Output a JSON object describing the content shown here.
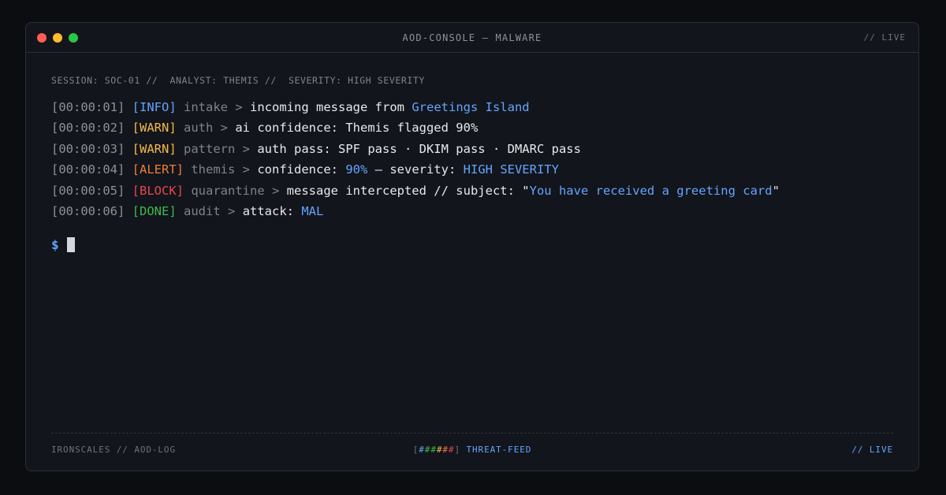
{
  "window": {
    "title": "AOD-CONSOLE — MALWARE",
    "live_label": "// LIVE",
    "dots": [
      {
        "name": "close",
        "color": "#ff5f57"
      },
      {
        "name": "minimize",
        "color": "#febc2e"
      },
      {
        "name": "maximize",
        "color": "#28c840"
      }
    ]
  },
  "session": {
    "text": "SESSION: SOC-01 //  ANALYST: THEMIS //  SEVERITY: HIGH SEVERITY"
  },
  "log": [
    {
      "ts": "[00:00:01]",
      "level": "[INFO]",
      "level_color": "#64a4ff",
      "source": "intake",
      "sep": " > ",
      "parts": [
        {
          "text": "incoming message from "
        },
        {
          "text": "Greetings Island",
          "hl": true
        }
      ]
    },
    {
      "ts": "[00:00:02]",
      "level": "[WARN]",
      "level_color": "#f5b84a",
      "source": "auth",
      "sep": " > ",
      "parts": [
        {
          "text": "ai confidence: Themis flagged 90%"
        }
      ]
    },
    {
      "ts": "[00:00:03]",
      "level": "[WARN]",
      "level_color": "#f5b84a",
      "source": "pattern",
      "sep": " > ",
      "parts": [
        {
          "text": "auth pass: SPF pass · DKIM pass · DMARC pass"
        }
      ]
    },
    {
      "ts": "[00:00:04]",
      "level": "[ALERT]",
      "level_color": "#f07b3f",
      "source": "themis",
      "sep": " > ",
      "parts": [
        {
          "text": "confidence: "
        },
        {
          "text": "90%",
          "hl": true
        },
        {
          "text": " — severity: "
        },
        {
          "text": "HIGH SEVERITY",
          "hl": true
        }
      ]
    },
    {
      "ts": "[00:00:05]",
      "level": "[BLOCK]",
      "level_color": "#e5484d",
      "source": "quarantine",
      "sep": " > ",
      "parts": [
        {
          "text": "message intercepted // subject: \""
        },
        {
          "text": "You have received a greeting card",
          "hl": true
        },
        {
          "text": "\""
        }
      ]
    },
    {
      "ts": "[00:00:06]",
      "level": "[DONE]",
      "level_color": "#3fb950",
      "source": "audit",
      "sep": " > ",
      "parts": [
        {
          "text": "attack: "
        },
        {
          "text": "MAL",
          "hl": true
        }
      ]
    }
  ],
  "prompt": {
    "symbol": "$"
  },
  "footer": {
    "left": "IRONSCALES // AOD-LOG",
    "threat_bar_open": "[",
    "threat_bar_segments": [
      {
        "text": "#",
        "color": "#64a4ff"
      },
      {
        "text": "#",
        "color": "#3fb950"
      },
      {
        "text": "#",
        "color": "#3fb950"
      },
      {
        "text": "#",
        "color": "#f5b84a"
      },
      {
        "text": "#",
        "color": "#f07b3f"
      },
      {
        "text": "#",
        "color": "#e5484d"
      }
    ],
    "threat_bar_close": "]",
    "center_label": "THREAT-FEED",
    "right": "// LIVE"
  },
  "colors": {
    "highlight": "#64a4ff",
    "text": "#e7e9ec",
    "muted": "#7d848e"
  }
}
